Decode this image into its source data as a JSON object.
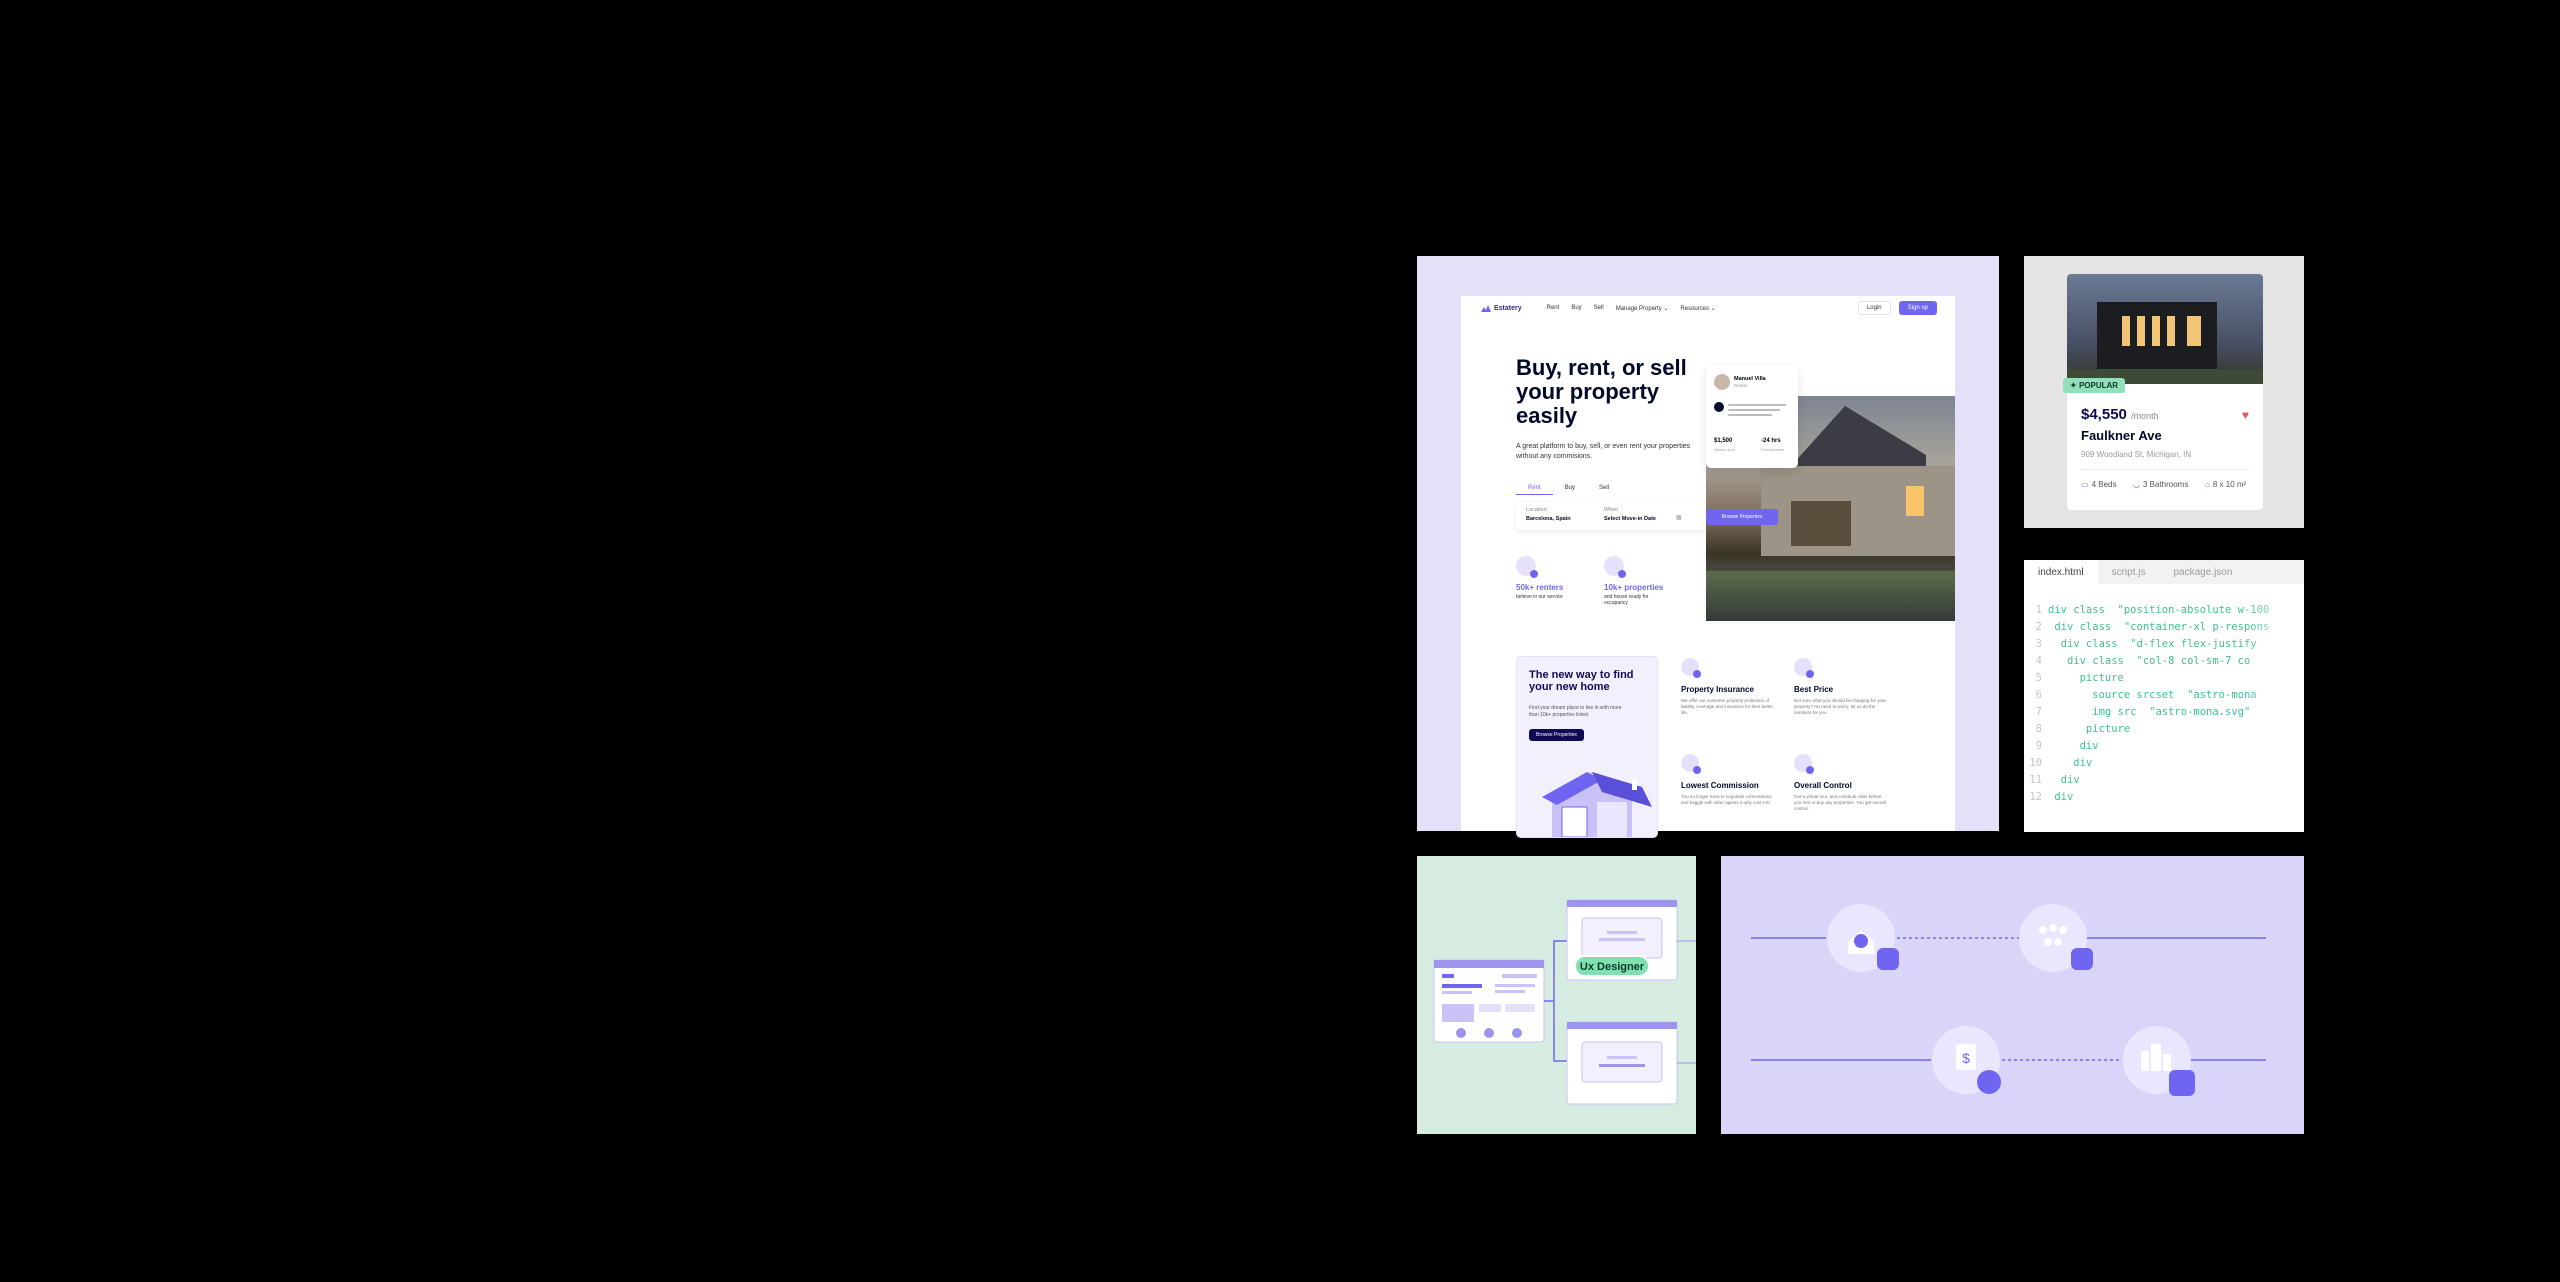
{
  "site": {
    "logo": "Estatery",
    "nav": [
      "Rent",
      "Buy",
      "Sell",
      "Manage Property ⌄",
      "Resources ⌄"
    ],
    "login": "Login",
    "signup": "Sign up",
    "hero_title": "Buy, rent, or sell your property easily",
    "hero_sub": "A great platform to buy, sell, or even rent your properties without any commisions.",
    "tabs": [
      "Rent",
      "Buy",
      "Sell"
    ],
    "search": {
      "location_label": "Location",
      "location_value": "Barcelona, Spain",
      "when_label": "When",
      "when_value": "Select Move-in Date"
    },
    "browse_button": "Browse Properties",
    "stats": [
      {
        "value": "50k+ renters",
        "label": "believe in our service"
      },
      {
        "value": "10k+ properties",
        "label": "and house ready for occupancy"
      }
    ],
    "profile_card": {
      "name": "Manuel Villa",
      "role": "Renter",
      "stat1_value": "$1,500",
      "stat1_label": "Saved up to",
      "stat2_value": "-24 hrs",
      "stat2_label": "Process time"
    },
    "promo": {
      "title": "The new way to find your new home",
      "subtitle": "Find your dream place to live in with more than 10k+ properties listed.",
      "button": "Browse Properties"
    },
    "features": [
      {
        "title": "Property Insurance",
        "desc": "We offer our customer property protection of liability coverage and insurance for their better life."
      },
      {
        "title": "Best Price",
        "desc": "Not sure what you should be charging for your property? No need to worry, let us do the numbers for you."
      },
      {
        "title": "Lowest Commission",
        "desc": "You no longer have to negotiate commissions and haggle with other agents it only cost 1%!"
      },
      {
        "title": "Overall Control",
        "desc": "Get a virtual tour, and schedule visits before you rent or buy any properties. You get overall control."
      }
    ]
  },
  "property": {
    "badge": "POPULAR",
    "price": "$4,550",
    "period": "/month",
    "name": "Faulkner Ave",
    "address": "909 Woodland St, Michigan, IN",
    "beds": "4 Beds",
    "baths": "3 Bathrooms",
    "area": "8 x 10 m²"
  },
  "code": {
    "tabs": [
      "index.html",
      "script.js",
      "package.json"
    ],
    "lines": [
      {
        "n": "1",
        "t": "div class  \"position-absolute w-100"
      },
      {
        "n": "2",
        "t": " div class  \"container-xl p-respons"
      },
      {
        "n": "3",
        "t": "  div class  \"d-flex flex-justify"
      },
      {
        "n": "4",
        "t": "   div class  \"col-8 col-sm-7 co"
      },
      {
        "n": "5",
        "t": "     picture"
      },
      {
        "n": "6",
        "t": "       source srcset  \"astro-mona"
      },
      {
        "n": "7",
        "t": "       img src  \"astro-mona.svg\""
      },
      {
        "n": "8",
        "t": "      picture"
      },
      {
        "n": "9",
        "t": "     div"
      },
      {
        "n": "10",
        "t": "    div"
      },
      {
        "n": "11",
        "t": "  div"
      },
      {
        "n": "12",
        "t": " div"
      }
    ]
  },
  "flow": {
    "tag": "Ux Designer"
  },
  "colors": {
    "accent": "#7065f0",
    "dark": "#100a55",
    "mint": "#8fe0bb"
  }
}
